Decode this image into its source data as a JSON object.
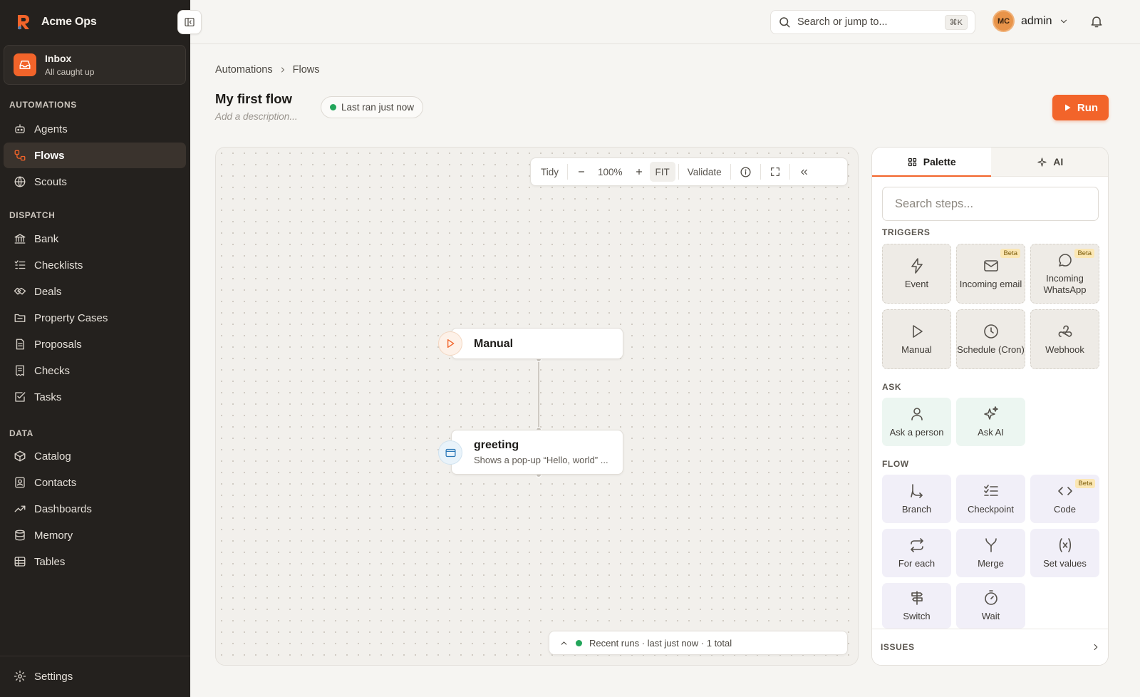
{
  "app": {
    "name": "Acme Ops"
  },
  "inbox": {
    "title": "Inbox",
    "subtitle": "All caught up"
  },
  "sidebar": {
    "automations_label": "AUTOMATIONS",
    "automations": [
      {
        "label": "Agents",
        "icon": "agent-icon"
      },
      {
        "label": "Flows",
        "icon": "flow-icon",
        "active": true
      },
      {
        "label": "Scouts",
        "icon": "globe-icon"
      }
    ],
    "dispatch_label": "DISPATCH",
    "dispatch": [
      {
        "label": "Bank",
        "icon": "bank-icon"
      },
      {
        "label": "Checklists",
        "icon": "checklist-icon"
      },
      {
        "label": "Deals",
        "icon": "handshake-icon"
      },
      {
        "label": "Property Cases",
        "icon": "folder-icon"
      },
      {
        "label": "Proposals",
        "icon": "document-icon"
      },
      {
        "label": "Checks",
        "icon": "receipt-icon"
      },
      {
        "label": "Tasks",
        "icon": "task-icon"
      }
    ],
    "data_label": "DATA",
    "data": [
      {
        "label": "Catalog",
        "icon": "package-icon"
      },
      {
        "label": "Contacts",
        "icon": "contact-icon"
      },
      {
        "label": "Dashboards",
        "icon": "trend-icon"
      },
      {
        "label": "Memory",
        "icon": "database-icon"
      },
      {
        "label": "Tables",
        "icon": "table-icon"
      }
    ],
    "settings_label": "Settings"
  },
  "topbar": {
    "search_placeholder": "Search or jump to...",
    "shortcut": "⌘K",
    "user_initials": "MC",
    "user_name": "admin"
  },
  "header": {
    "breadcrumb": [
      "Automations",
      "Flows"
    ],
    "title": "My first flow",
    "description_placeholder": "Add a description...",
    "status": "Last ran just now",
    "run_label": "Run"
  },
  "canvas": {
    "toolbar": {
      "tidy": "Tidy",
      "zoom": "100%",
      "fit": "FIT",
      "validate": "Validate"
    },
    "nodes": [
      {
        "title": "Manual",
        "icon": "play-icon"
      },
      {
        "title": "greeting",
        "subtitle": "Shows a pop-up “Hello, world” ...",
        "icon": "window-icon"
      }
    ],
    "recent_runs": "Recent runs · last just now · 1 total"
  },
  "palette": {
    "tabs": [
      "Palette",
      "AI"
    ],
    "search_placeholder": "Search steps...",
    "triggers_label": "TRIGGERS",
    "triggers": [
      {
        "label": "Event",
        "icon": "bolt-icon"
      },
      {
        "label": "Incoming email",
        "icon": "mail-icon",
        "badge": "Beta"
      },
      {
        "label": "Incoming WhatsApp",
        "icon": "chat-icon",
        "badge": "Beta"
      },
      {
        "label": "Manual",
        "icon": "play-icon"
      },
      {
        "label": "Schedule (Cron)",
        "icon": "clock-icon"
      },
      {
        "label": "Webhook",
        "icon": "webhook-icon"
      }
    ],
    "ask_label": "ASK",
    "ask": [
      {
        "label": "Ask a person",
        "icon": "person-icon"
      },
      {
        "label": "Ask AI",
        "icon": "sparkle-icon"
      }
    ],
    "flow_label": "FLOW",
    "flow": [
      {
        "label": "Branch",
        "icon": "branch-icon"
      },
      {
        "label": "Checkpoint",
        "icon": "checkpoint-icon"
      },
      {
        "label": "Code",
        "icon": "code-icon",
        "badge": "Beta"
      },
      {
        "label": "For each",
        "icon": "loop-icon"
      },
      {
        "label": "Merge",
        "icon": "merge-icon"
      },
      {
        "label": "Set values",
        "icon": "variable-icon"
      },
      {
        "label": "Switch",
        "icon": "signpost-icon"
      },
      {
        "label": "Wait",
        "icon": "timer-icon"
      }
    ],
    "issues_label": "ISSUES"
  },
  "colors": {
    "accent": "#f2642a",
    "sidebar": "#24211e",
    "success": "#22a55a"
  }
}
